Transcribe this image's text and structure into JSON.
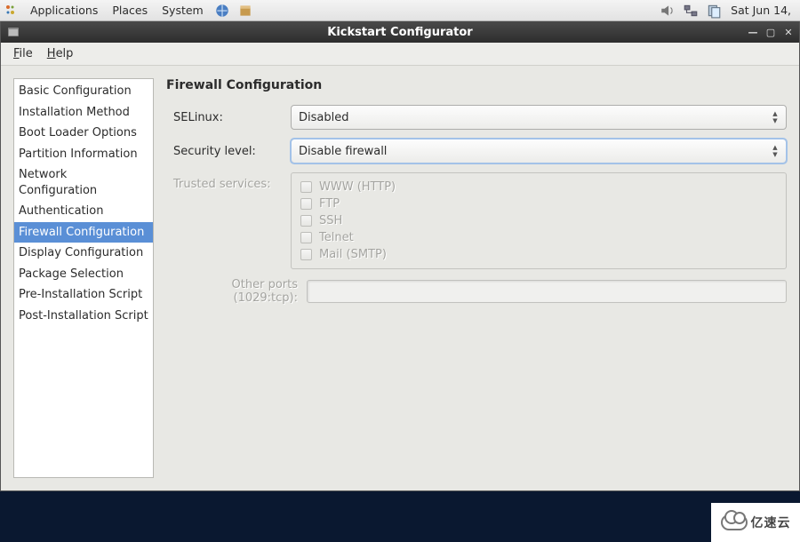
{
  "panel": {
    "applications": "Applications",
    "places": "Places",
    "system": "System",
    "clock": "Sat Jun 14,"
  },
  "window": {
    "title": "Kickstart Configurator",
    "menus": {
      "file": "File",
      "help": "Help"
    }
  },
  "sidebar": {
    "items": [
      "Basic Configuration",
      "Installation Method",
      "Boot Loader Options",
      "Partition Information",
      "Network Configuration",
      "Authentication",
      "Firewall Configuration",
      "Display Configuration",
      "Package Selection",
      "Pre-Installation Script",
      "Post-Installation Script"
    ],
    "selectedIndex": 6
  },
  "main": {
    "title": "Firewall Configuration",
    "selinux_label": "SELinux:",
    "selinux_value": "Disabled",
    "seclevel_label": "Security level:",
    "seclevel_value": "Disable firewall",
    "trusted_label": "Trusted services:",
    "services": [
      "WWW (HTTP)",
      "FTP",
      "SSH",
      "Telnet",
      "Mail (SMTP)"
    ],
    "other_ports_label": "Other ports (1029:tcp):"
  },
  "watermark": "亿速云"
}
